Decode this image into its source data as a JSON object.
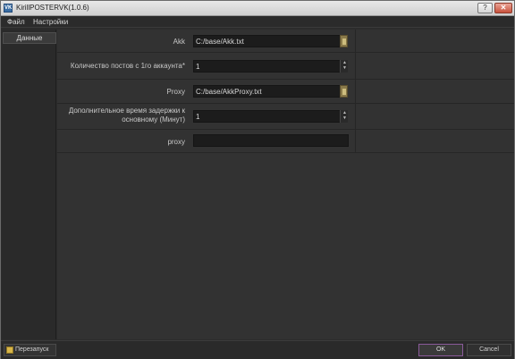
{
  "window": {
    "title": "KirillPOSTERVK(1.0.6)",
    "app_icon": "VK"
  },
  "titlebar": {
    "help_label": "?",
    "close_label": "✕"
  },
  "menu": {
    "items": [
      "Файл",
      "Настройки"
    ]
  },
  "sidebar": {
    "tab_label": "Данные"
  },
  "form": {
    "akk": {
      "label": "Akk",
      "value": "C:/base/Akk.txt"
    },
    "posts_count": {
      "label": "Количество постов с 1го аккаунта*",
      "value": "1"
    },
    "proxy_file": {
      "label": "Proxy",
      "value": "C:/base/AkkProxy.txt"
    },
    "extra_delay": {
      "label": "Дополнительное время задержки к основному (Минут)",
      "value": "1"
    },
    "proxy": {
      "label": "proxy",
      "value": ""
    }
  },
  "bottom": {
    "restart_label": "Перезапуск",
    "ok_label": "OK",
    "cancel_label": "Cancel"
  }
}
